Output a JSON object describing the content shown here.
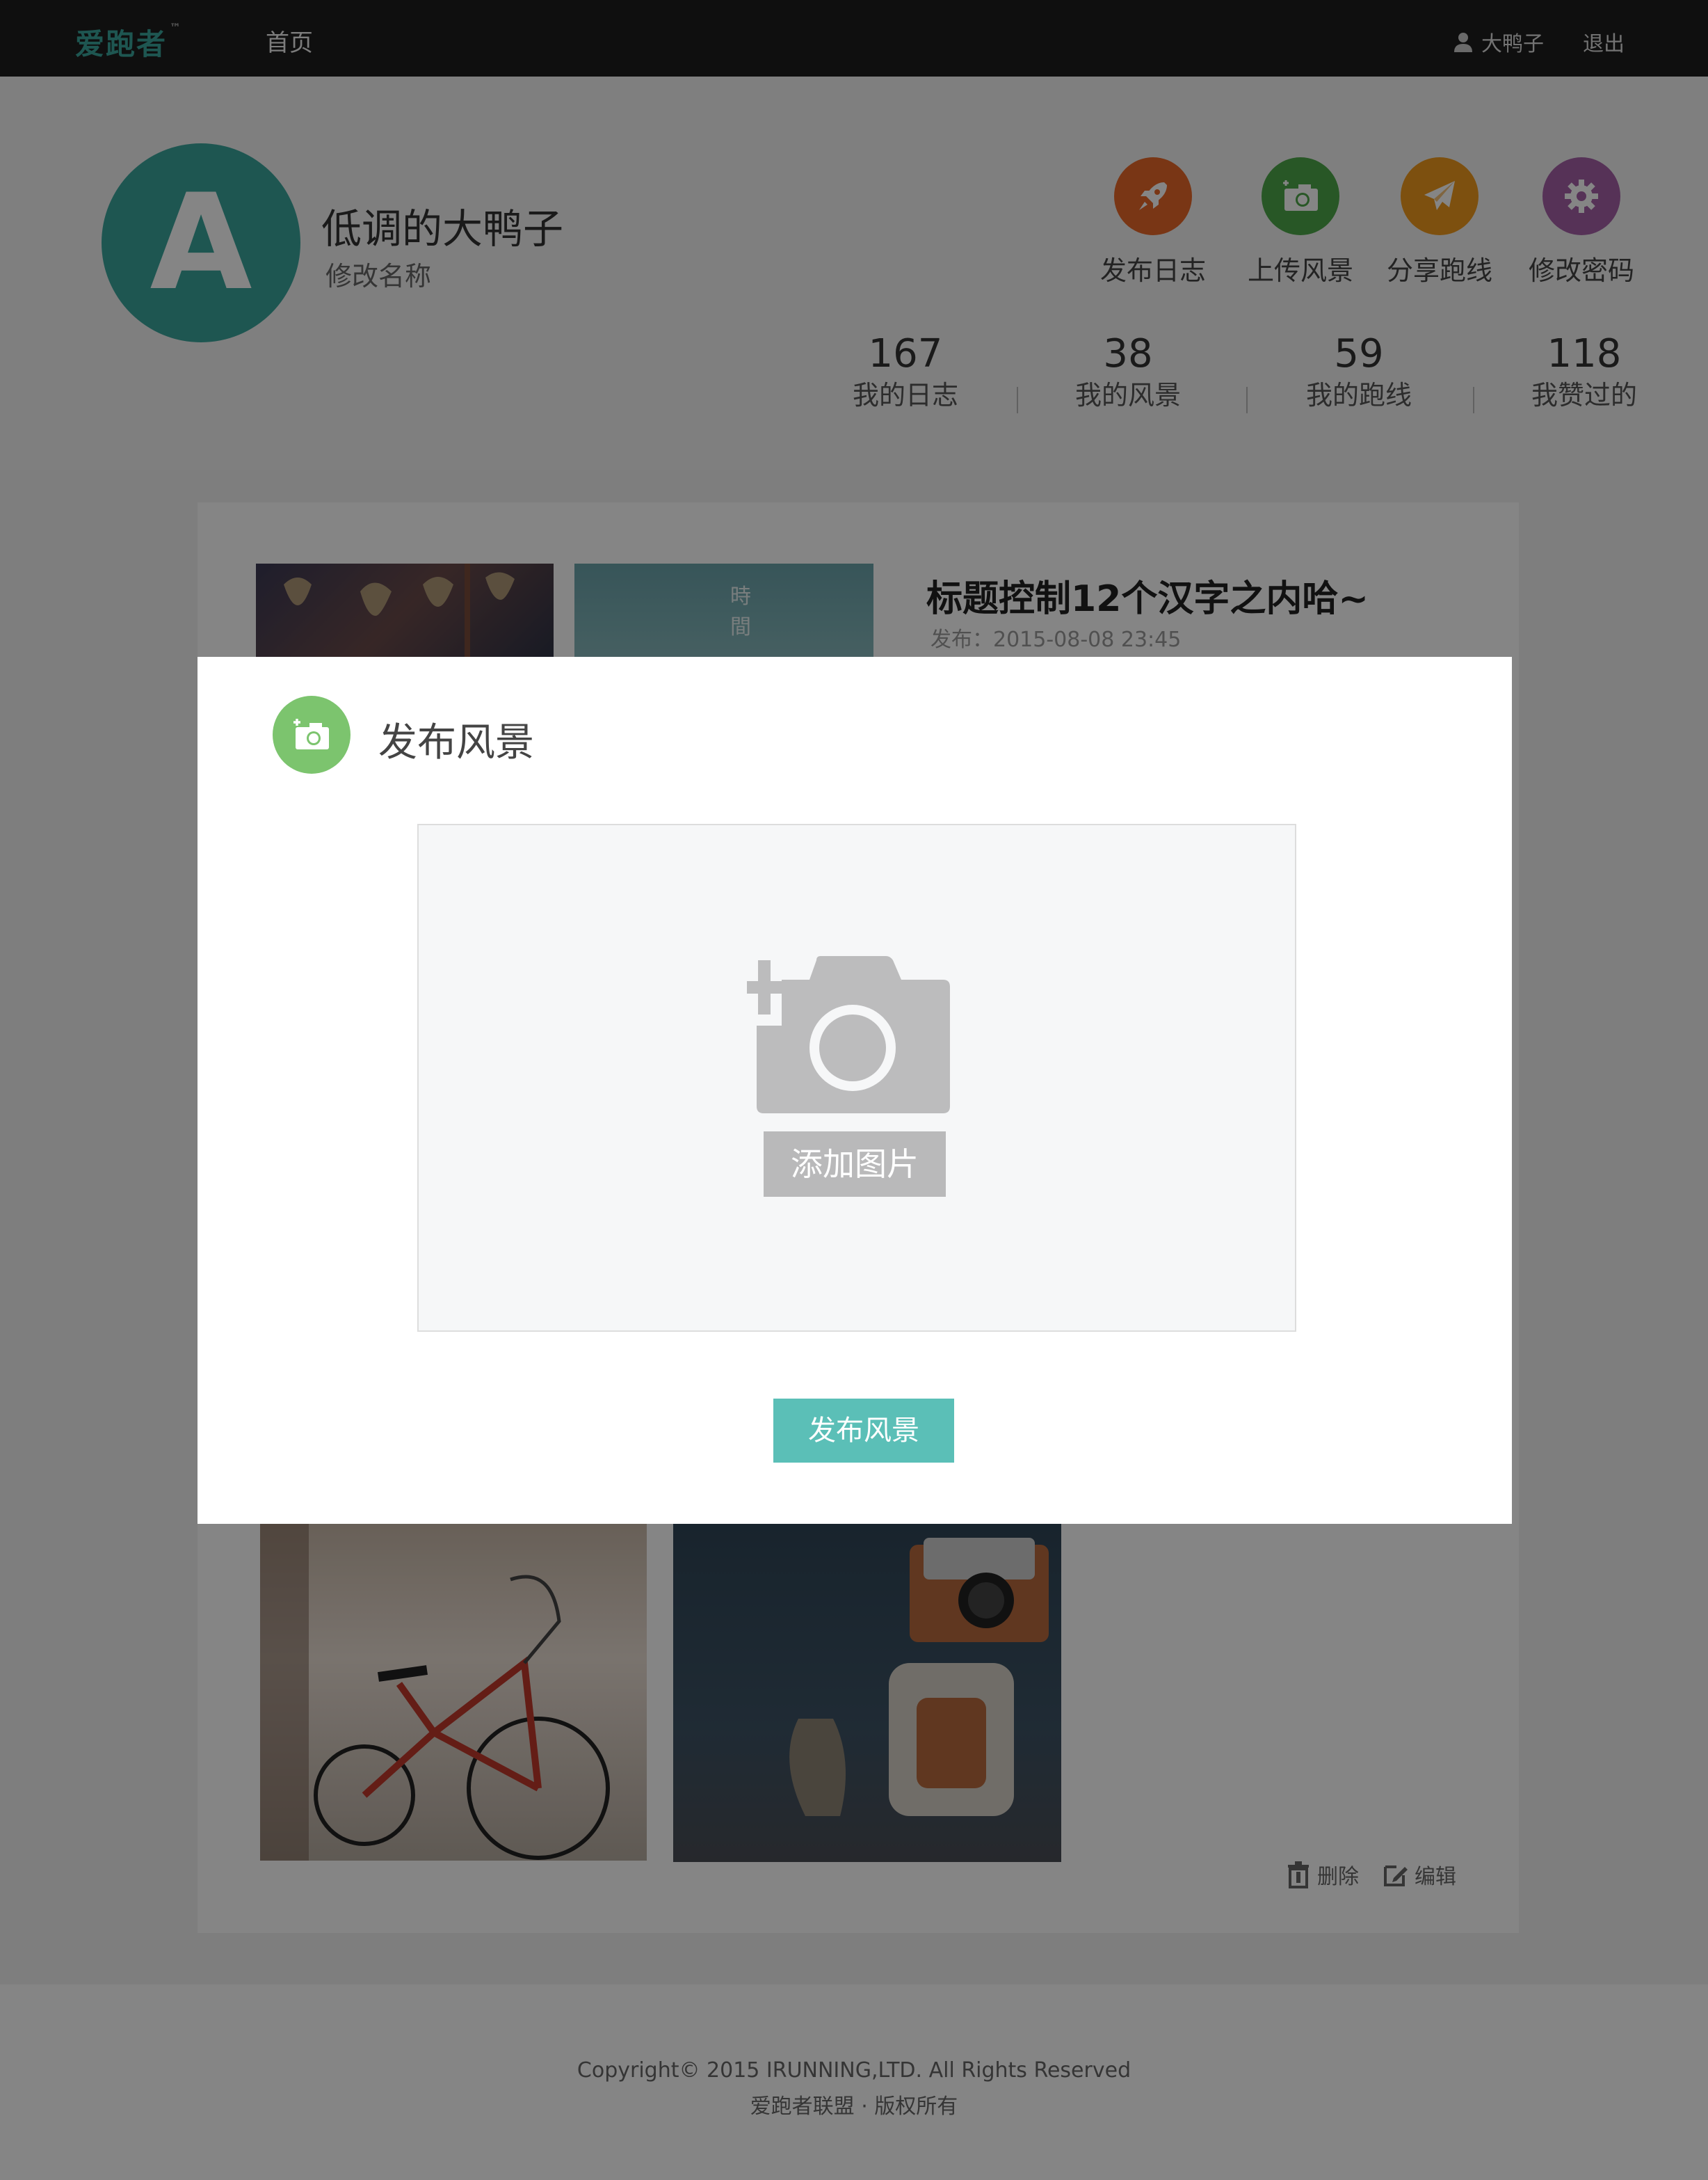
{
  "header": {
    "logo": "爱跑者",
    "logo_tm": "™",
    "nav_home": "首页",
    "username": "大鸭子",
    "logout": "退出"
  },
  "profile": {
    "avatar_letter": "A",
    "name": "低调的大鸭子",
    "edit_name": "修改名称",
    "actions": [
      {
        "label": "发布日志",
        "icon": "rocket-icon",
        "color": "#e8682a"
      },
      {
        "label": "上传风景",
        "icon": "camera-plus-icon",
        "color": "#4ea84a"
      },
      {
        "label": "分享跑线",
        "icon": "paper-plane-icon",
        "color": "#f09a1d"
      },
      {
        "label": "修改密码",
        "icon": "gear-icon",
        "color": "#a661a8"
      }
    ],
    "stats": [
      {
        "value": "167",
        "label": "我的日志"
      },
      {
        "value": "38",
        "label": "我的风景"
      },
      {
        "value": "59",
        "label": "我的跑线"
      },
      {
        "value": "118",
        "label": "我赞过的"
      }
    ]
  },
  "post": {
    "title": "标题控制12个汉字之内哈~",
    "date": "发布：2015-08-08 23:45",
    "delete": "删除",
    "edit": "编辑",
    "thumb_text": "時 間"
  },
  "modal": {
    "title": "发布风景",
    "add_image": "添加图片",
    "submit": "发布风景"
  },
  "footer": {
    "copyright": "Copyright© 2015 IRUNNING,LTD. All Rights Reserved",
    "rights": "爱跑者联盟 · 版权所有"
  },
  "colors": {
    "brand": "#3aa59c",
    "submit": "#5bbfb7",
    "modal_icon": "#7cc46e"
  }
}
